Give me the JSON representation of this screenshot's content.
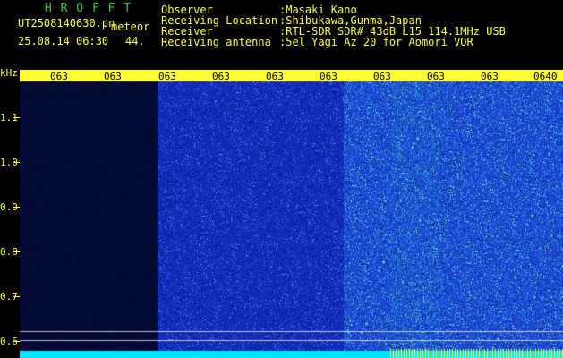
{
  "header": {
    "program": "H R O F F T",
    "filename": "UT2508140630.pn",
    "tag": "meteor",
    "datetime": "25.08.14 06:30",
    "count": "44."
  },
  "station": {
    "rows": [
      {
        "label": "Observer",
        "value": ":Masaki Kano"
      },
      {
        "label": "Receiving Location",
        "value": ":Shibukawa,Gunma,Japan"
      },
      {
        "label": "Receiver",
        "value": ":RTL-SDR SDR# 43dB L15 114.1MHz USB"
      },
      {
        "label": "Receiving antenna",
        "value": ":5el Yagi Az 20 for Aomori VOR"
      }
    ]
  },
  "y_axis": {
    "unit": "kHz",
    "ticks": [
      "1.1",
      "1.0",
      "0.9",
      "0.8",
      "0.7",
      "0.6"
    ]
  },
  "time_labels": [
    "063",
    "063",
    "063",
    "063",
    "063",
    "063",
    "063",
    "063",
    "063",
    "063",
    "0640"
  ],
  "colors": {
    "text": "#ffff33",
    "title": "#33cc33",
    "background": "#000000",
    "waterfall_dark": "#060a3a",
    "waterfall_blue": "#1a2ec0",
    "trace": "#00e5ff"
  }
}
